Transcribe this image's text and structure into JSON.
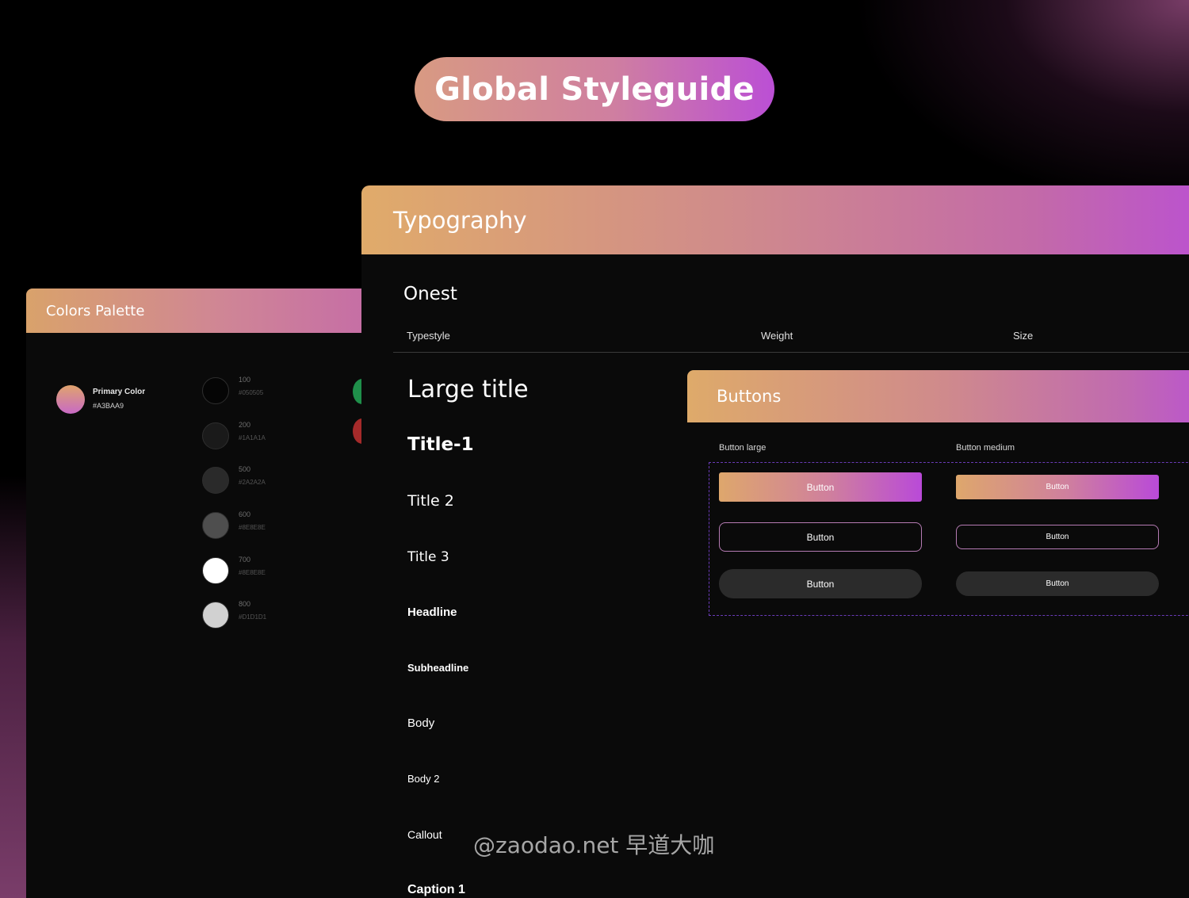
{
  "hero": {
    "title": "Global Styleguide"
  },
  "colors_panel": {
    "title": "Colors Palette",
    "primary": {
      "label": "Primary Color",
      "hex": "#A3BAA9"
    },
    "swatches": [
      {
        "num": "100",
        "hex": "#050505",
        "color": "#050505"
      },
      {
        "num": "200",
        "hex": "#1A1A1A",
        "color": "#1a1a1a"
      },
      {
        "num": "500",
        "hex": "#2A2A2A",
        "color": "#2a2a2a"
      },
      {
        "num": "600",
        "hex": "#8E8E8E",
        "color": "#4e4e4e"
      },
      {
        "num": "700",
        "hex": "#8E8E8E",
        "color": "#ffffff"
      },
      {
        "num": "800",
        "hex": "#D1D1D1",
        "color": "#d1d1d1"
      }
    ],
    "accent_colors": [
      "#1f8f4a",
      "#a52a2a"
    ]
  },
  "typography_panel": {
    "title": "Typography",
    "font_name": "Onest",
    "columns": {
      "typestyle": "Typestyle",
      "weight": "Weight",
      "size": "Size"
    },
    "styles": [
      {
        "name": "Large title"
      },
      {
        "name": "Title-1"
      },
      {
        "name": "Title 2"
      },
      {
        "name": "Title 3"
      },
      {
        "name": "Headline"
      },
      {
        "name": "Subheadline"
      },
      {
        "name": "Body"
      },
      {
        "name": "Body 2"
      },
      {
        "name": "Callout"
      },
      {
        "name": "Caption 1"
      }
    ]
  },
  "buttons_panel": {
    "title": "Buttons",
    "large_label": "Button large",
    "medium_label": "Button medium",
    "button_text": "Button"
  },
  "watermark": "@zaodao.net 早道大咖"
}
